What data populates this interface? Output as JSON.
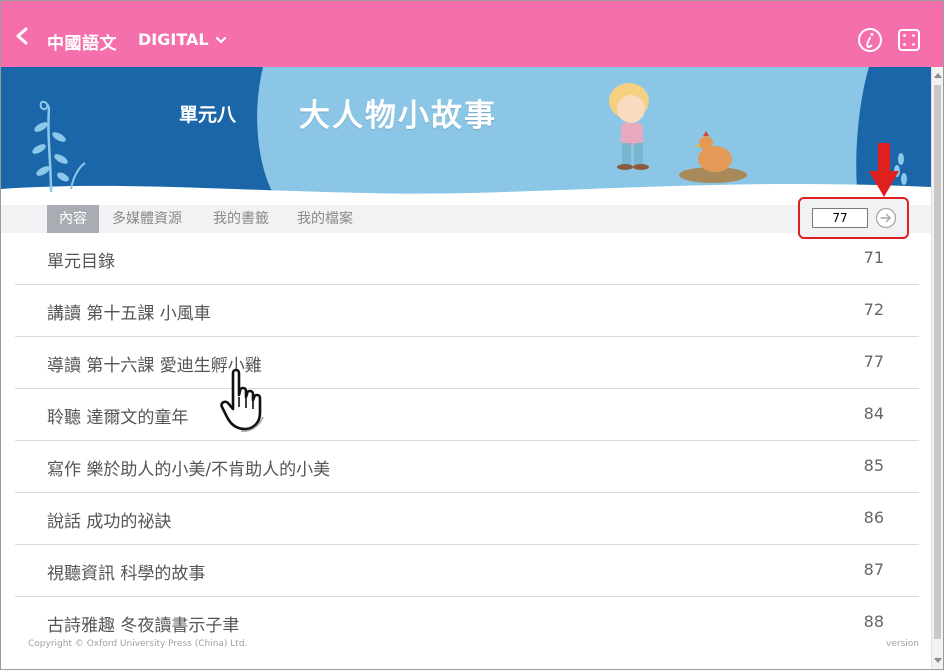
{
  "header": {
    "back_icon": "chevron-left-icon",
    "app_title": "中國語文",
    "book_selector": "DIGITAL",
    "info_icon": "info-icon",
    "fullscreen_icon": "fullscreen-icon",
    "bar_color": "#f46fac"
  },
  "banner": {
    "unit": "單元八",
    "title": "大人物小故事",
    "sky_color": "#8bc6e6",
    "dark_color": "#1a66a8"
  },
  "tabs": [
    {
      "label": "內容",
      "active": true
    },
    {
      "label": "多媒體資源",
      "active": false
    },
    {
      "label": "我的書籤",
      "active": false
    },
    {
      "label": "我的檔案",
      "active": false
    }
  ],
  "goto": {
    "page_value": "77",
    "go_icon": "arrow-right-circle-icon",
    "highlight_color": "#e0201e"
  },
  "contents": [
    {
      "label": "單元目錄",
      "page": "71"
    },
    {
      "label": "講讀 第十五課 小風車",
      "page": "72"
    },
    {
      "label": "導讀 第十六課 愛迪生孵小雞",
      "page": "77"
    },
    {
      "label": "聆聽 達爾文的童年",
      "page": "84"
    },
    {
      "label": "寫作 樂於助人的小美/不肯助人的小美",
      "page": "85"
    },
    {
      "label": "說話 成功的祕訣",
      "page": "86"
    },
    {
      "label": "視聽資訊 科學的故事",
      "page": "87"
    },
    {
      "label": "古詩雅趣 冬夜讀書示子聿",
      "page": "88"
    }
  ],
  "footer": {
    "copyright": "Copyright © Oxford University Press (China) Ltd.",
    "version": "version"
  }
}
